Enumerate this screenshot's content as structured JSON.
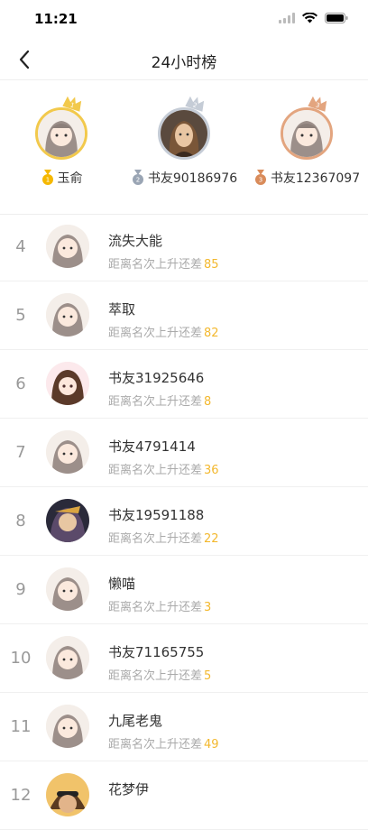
{
  "status": {
    "time": "11:21"
  },
  "nav": {
    "title": "24小时榜"
  },
  "podium": [
    {
      "rank": "1",
      "name": "玉俞",
      "ring_color": "#f2c94c",
      "medal_color": "#f5b800"
    },
    {
      "rank": "2",
      "name": "书友90186976",
      "ring_color": "#c5ccd6",
      "medal_color": "#9aa5b4"
    },
    {
      "rank": "3",
      "name": "书友12367097",
      "ring_color": "#e3a57f",
      "medal_color": "#d98b5a"
    }
  ],
  "list": {
    "sub_prefix": "距离名次上升还差",
    "rows": [
      {
        "rank": "4",
        "name": "流失大能",
        "gap": "85"
      },
      {
        "rank": "5",
        "name": "萃取",
        "gap": "82"
      },
      {
        "rank": "6",
        "name": "书友31925646",
        "gap": "8"
      },
      {
        "rank": "7",
        "name": "书友4791414",
        "gap": "36"
      },
      {
        "rank": "8",
        "name": "书友19591188",
        "gap": "22"
      },
      {
        "rank": "9",
        "name": "懒喵",
        "gap": "3"
      },
      {
        "rank": "10",
        "name": "书友71165755",
        "gap": "5"
      },
      {
        "rank": "11",
        "name": "九尾老鬼",
        "gap": "49"
      },
      {
        "rank": "12",
        "name": "花梦伊",
        "gap": ""
      }
    ]
  },
  "colors": {
    "accent": "#f3b82e",
    "gap_text": "#f3b82e"
  }
}
